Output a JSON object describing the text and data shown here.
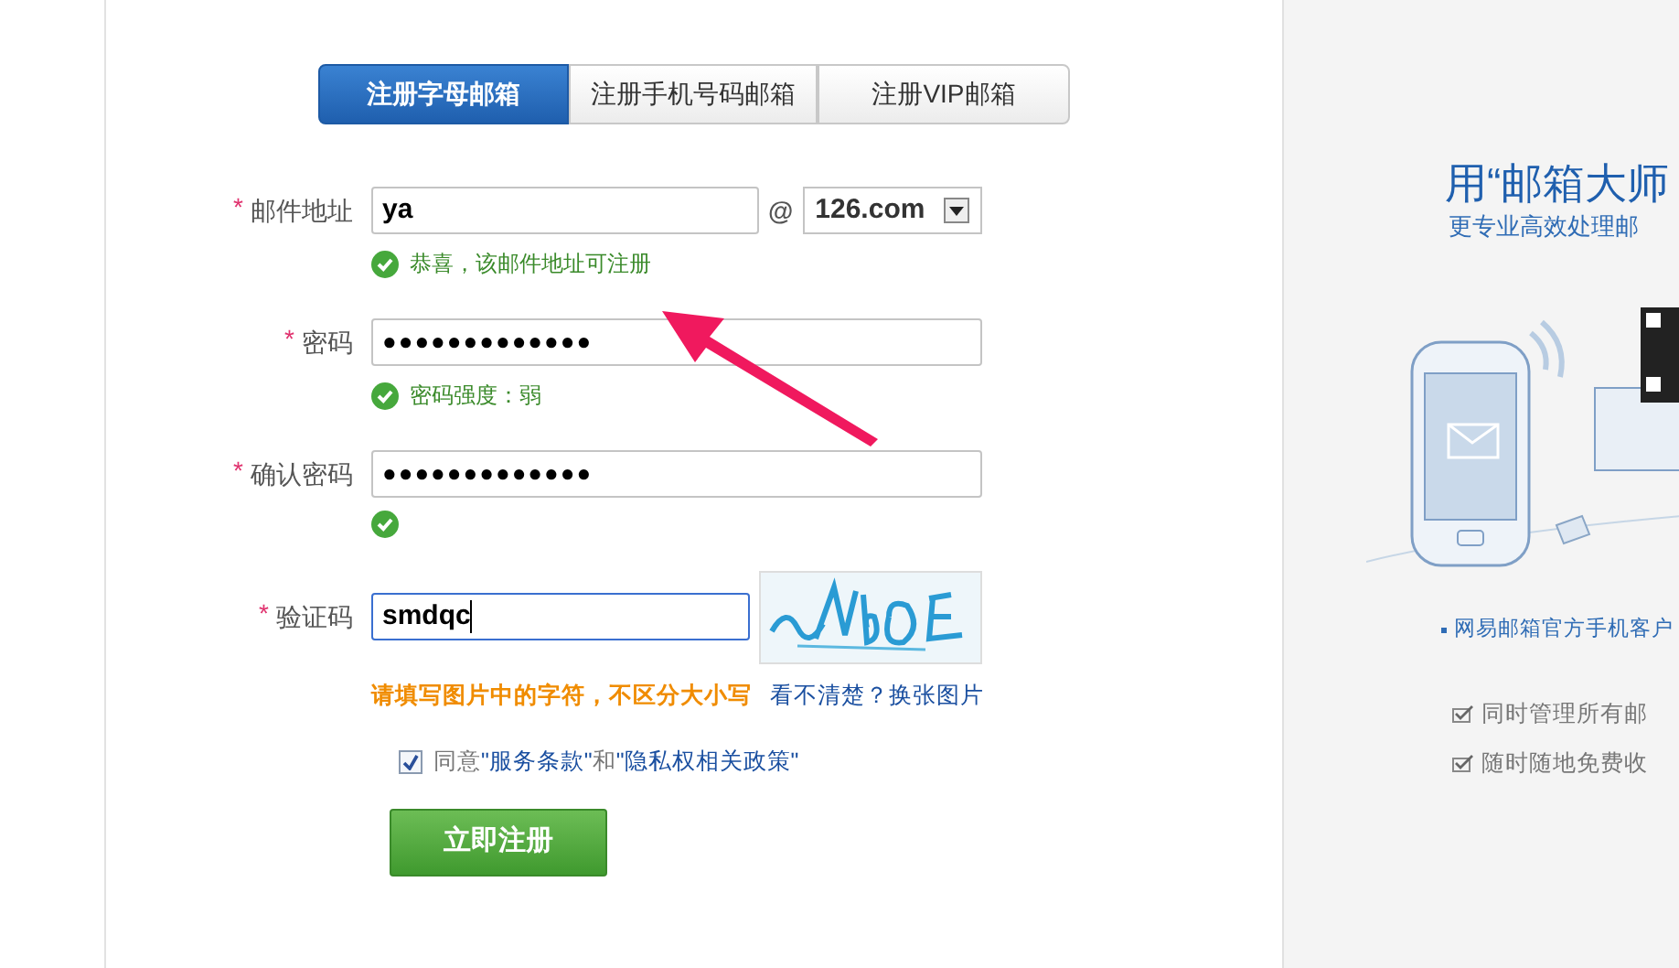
{
  "tabs": [
    {
      "label": "注册字母邮箱",
      "selected": true
    },
    {
      "label": "注册手机号码邮箱",
      "selected": false
    },
    {
      "label": "注册VIP邮箱",
      "selected": false
    }
  ],
  "fields": [
    {
      "kind": "email",
      "label": "邮件地址",
      "required_mark": "*",
      "value": "ya",
      "at": "@",
      "domain": "126.com",
      "valid": true,
      "message": "恭喜，该邮件地址可注册"
    },
    {
      "kind": "password",
      "label": "密码",
      "required_mark": "*",
      "value": "●●●●●●●●●●●●●",
      "valid": true,
      "message": "密码强度：弱"
    },
    {
      "kind": "password",
      "label": "确认密码",
      "required_mark": "*",
      "value": "●●●●●●●●●●●●●",
      "valid": true
    },
    {
      "kind": "captcha",
      "label": "验证码",
      "required_mark": "*",
      "value": "smdqc",
      "focused": true,
      "hint": "请填写图片中的字符，不区分大小写",
      "refresh_link": "看不清楚？换张图片"
    }
  ],
  "agreement": {
    "checked": true,
    "parts": [
      {
        "kind": "text",
        "text": "同意"
      },
      {
        "kind": "link",
        "text": "\"服务条款\""
      },
      {
        "kind": "text",
        "text": "和"
      },
      {
        "kind": "link",
        "text": "\"隐私权相关政策\""
      }
    ]
  },
  "submit": "立即注册",
  "promo": {
    "title": "用“邮箱大师",
    "subtitle": "更专业高效处理邮",
    "caption": "网易邮箱官方手机客户",
    "features": [
      {
        "text": "同时管理所有邮",
        "checked": true
      },
      {
        "text": "随时随地免费收",
        "checked": true
      }
    ]
  }
}
